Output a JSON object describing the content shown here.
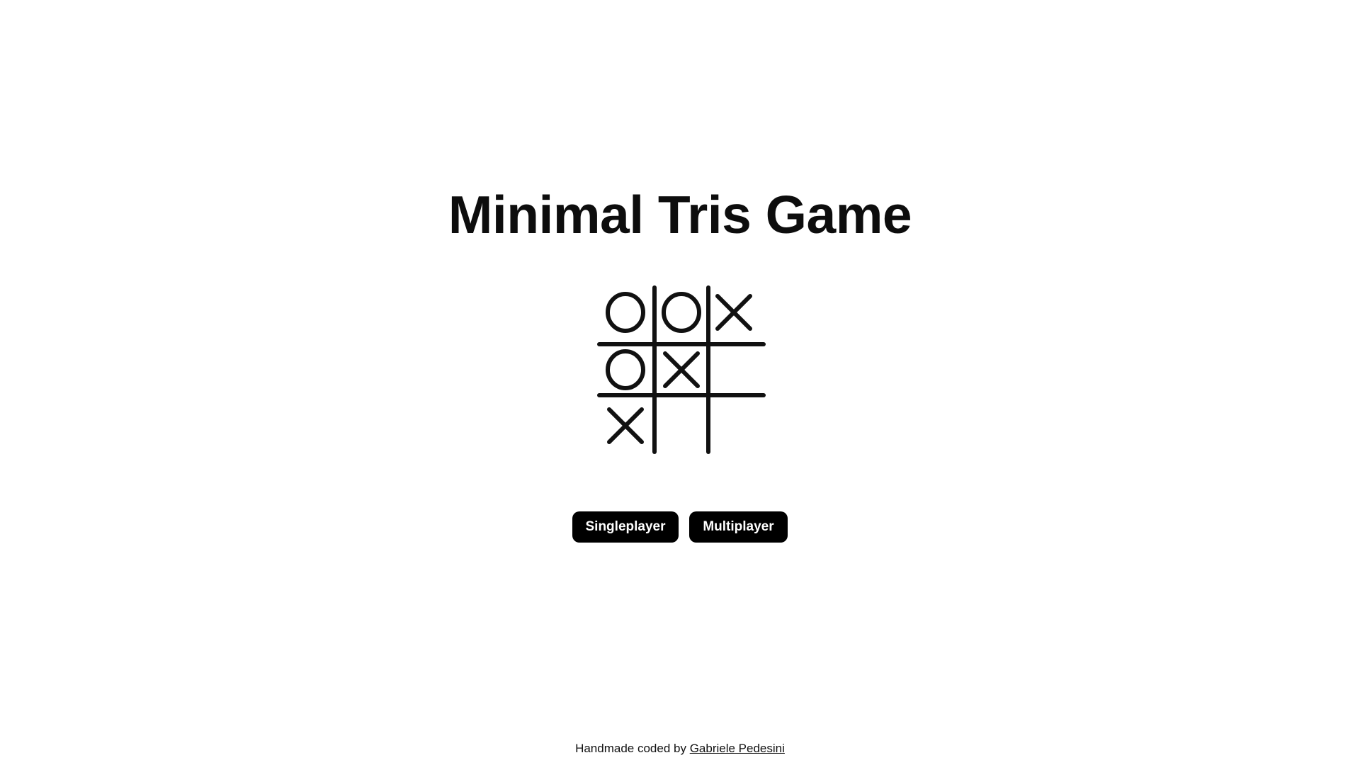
{
  "title": "Minimal Tris Game",
  "logo": {
    "icon": "tic-tac-toe-board-icon",
    "cells": [
      [
        "O",
        "O",
        "X"
      ],
      [
        "O",
        "X",
        ""
      ],
      [
        "X",
        "",
        ""
      ]
    ]
  },
  "buttons": {
    "singleplayer": "Singleplayer",
    "multiplayer": "Multiplayer"
  },
  "footer": {
    "prefix": "Handmade coded by",
    "author": "Gabriele Pedesini"
  },
  "colors": {
    "text": "#0d0d0d",
    "button_bg": "#000000",
    "button_text": "#ffffff",
    "background": "#ffffff"
  }
}
